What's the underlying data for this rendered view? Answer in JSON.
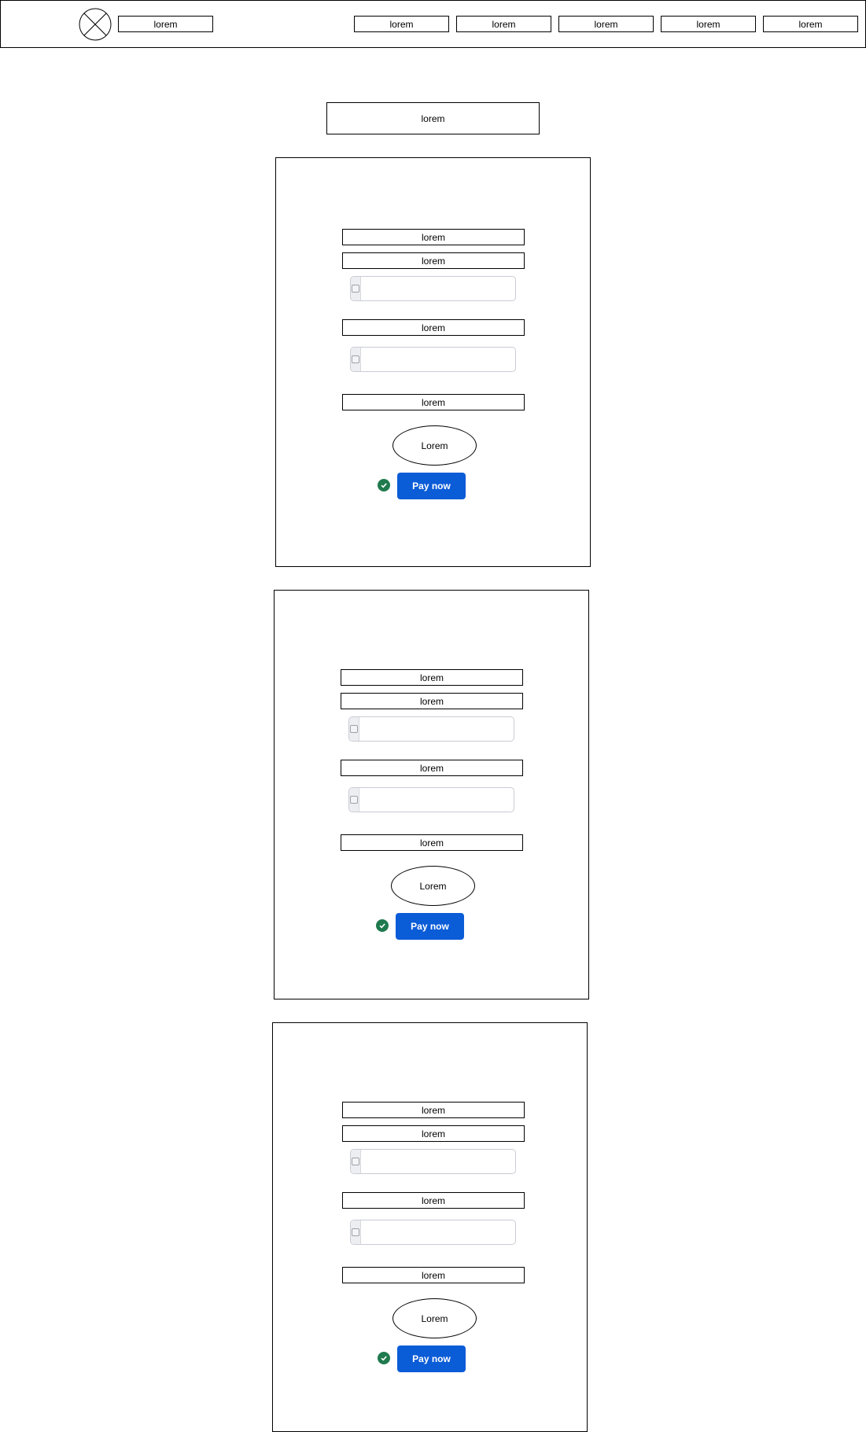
{
  "header": {
    "brand_label": "lorem",
    "nav": [
      "lorem",
      "lorem",
      "lorem",
      "lorem",
      "lorem"
    ]
  },
  "page": {
    "title": "lorem"
  },
  "cards": [
    {
      "label_1": "lorem",
      "label_2": "lorem",
      "label_3": "lorem",
      "label_4": "lorem",
      "input_1_value": "",
      "input_2_value": "",
      "oval_label": "Lorem",
      "pay_label": "Pay now"
    },
    {
      "label_1": "lorem",
      "label_2": "lorem",
      "label_3": "lorem",
      "label_4": "lorem",
      "input_1_value": "",
      "input_2_value": "",
      "oval_label": "Lorem",
      "pay_label": "Pay now"
    },
    {
      "label_1": "lorem",
      "label_2": "lorem",
      "label_3": "lorem",
      "label_4": "lorem",
      "input_1_value": "",
      "input_2_value": "",
      "oval_label": "Lorem",
      "pay_label": "Pay now"
    }
  ],
  "colors": {
    "pay_button": "#0b5cd7",
    "check_icon": "#1f7a4d",
    "input_border": "#c9ccd3"
  }
}
